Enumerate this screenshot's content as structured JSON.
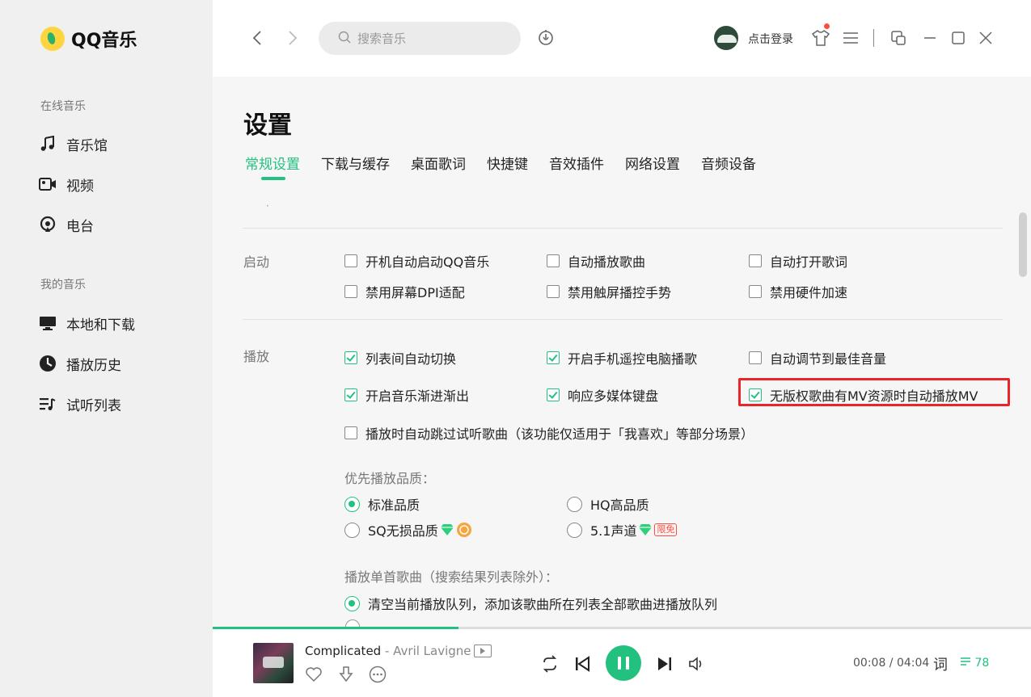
{
  "app": {
    "name": "QQ音乐"
  },
  "sidebar": {
    "groups": [
      {
        "title": "在线音乐",
        "items": [
          {
            "label": "音乐馆",
            "icon": "music-note-icon"
          },
          {
            "label": "视频",
            "icon": "video-camera-icon"
          },
          {
            "label": "电台",
            "icon": "radio-icon"
          }
        ]
      },
      {
        "title": "我的音乐",
        "items": [
          {
            "label": "本地和下载",
            "icon": "monitor-icon"
          },
          {
            "label": "播放历史",
            "icon": "clock-icon"
          },
          {
            "label": "试听列表",
            "icon": "playlist-icon"
          }
        ]
      }
    ]
  },
  "topbar": {
    "search_placeholder": "搜索音乐",
    "login_label": "点击登录"
  },
  "settings": {
    "title": "设置",
    "tabs": [
      "常规设置",
      "下载与缓存",
      "桌面歌词",
      "快捷键",
      "音效插件",
      "网络设置",
      "音频设备"
    ],
    "active_tab": "常规设置",
    "startup": {
      "label": "启动",
      "options": [
        {
          "label": "开机自动启动QQ音乐",
          "checked": false
        },
        {
          "label": "自动播放歌曲",
          "checked": false
        },
        {
          "label": "自动打开歌词",
          "checked": false
        },
        {
          "label": "禁用屏幕DPI适配",
          "checked": false
        },
        {
          "label": "禁用触屏播控手势",
          "checked": false
        },
        {
          "label": "禁用硬件加速",
          "checked": false
        }
      ]
    },
    "playback": {
      "label": "播放",
      "options": [
        {
          "label": "列表间自动切换",
          "checked": true
        },
        {
          "label": "开启手机遥控电脑播歌",
          "checked": true
        },
        {
          "label": "自动调节到最佳音量",
          "checked": false
        },
        {
          "label": "开启音乐渐进渐出",
          "checked": true
        },
        {
          "label": "响应多媒体键盘",
          "checked": true
        },
        {
          "label": "无版权歌曲有MV资源时自动播放MV",
          "checked": true
        },
        {
          "label": "播放时自动跳过试听歌曲（该功能仅适用于「我喜欢」等部分场景）",
          "checked": false
        }
      ],
      "quality_label": "优先播放品质：",
      "quality_options": [
        {
          "label": "标准品质",
          "selected": true
        },
        {
          "label": "HQ高品质",
          "selected": false
        },
        {
          "label": "SQ无损品质",
          "selected": false
        },
        {
          "label": "5.1声道",
          "selected": false,
          "badge": "限免"
        }
      ],
      "single_label": "播放单首歌曲（搜索结果列表除外）：",
      "single_options": [
        {
          "label": "清空当前播放队列，添加该歌曲所在列表全部歌曲进播放队列",
          "selected": true
        }
      ]
    }
  },
  "player": {
    "song": "Complicated",
    "artist": " - Avril Lavigne",
    "progress": 0.3,
    "time": "00:08 / 04:04",
    "lyric_label": "词",
    "playlist_count": "78"
  },
  "colors": {
    "accent": "#22c180",
    "highlight": "#e8262a"
  }
}
